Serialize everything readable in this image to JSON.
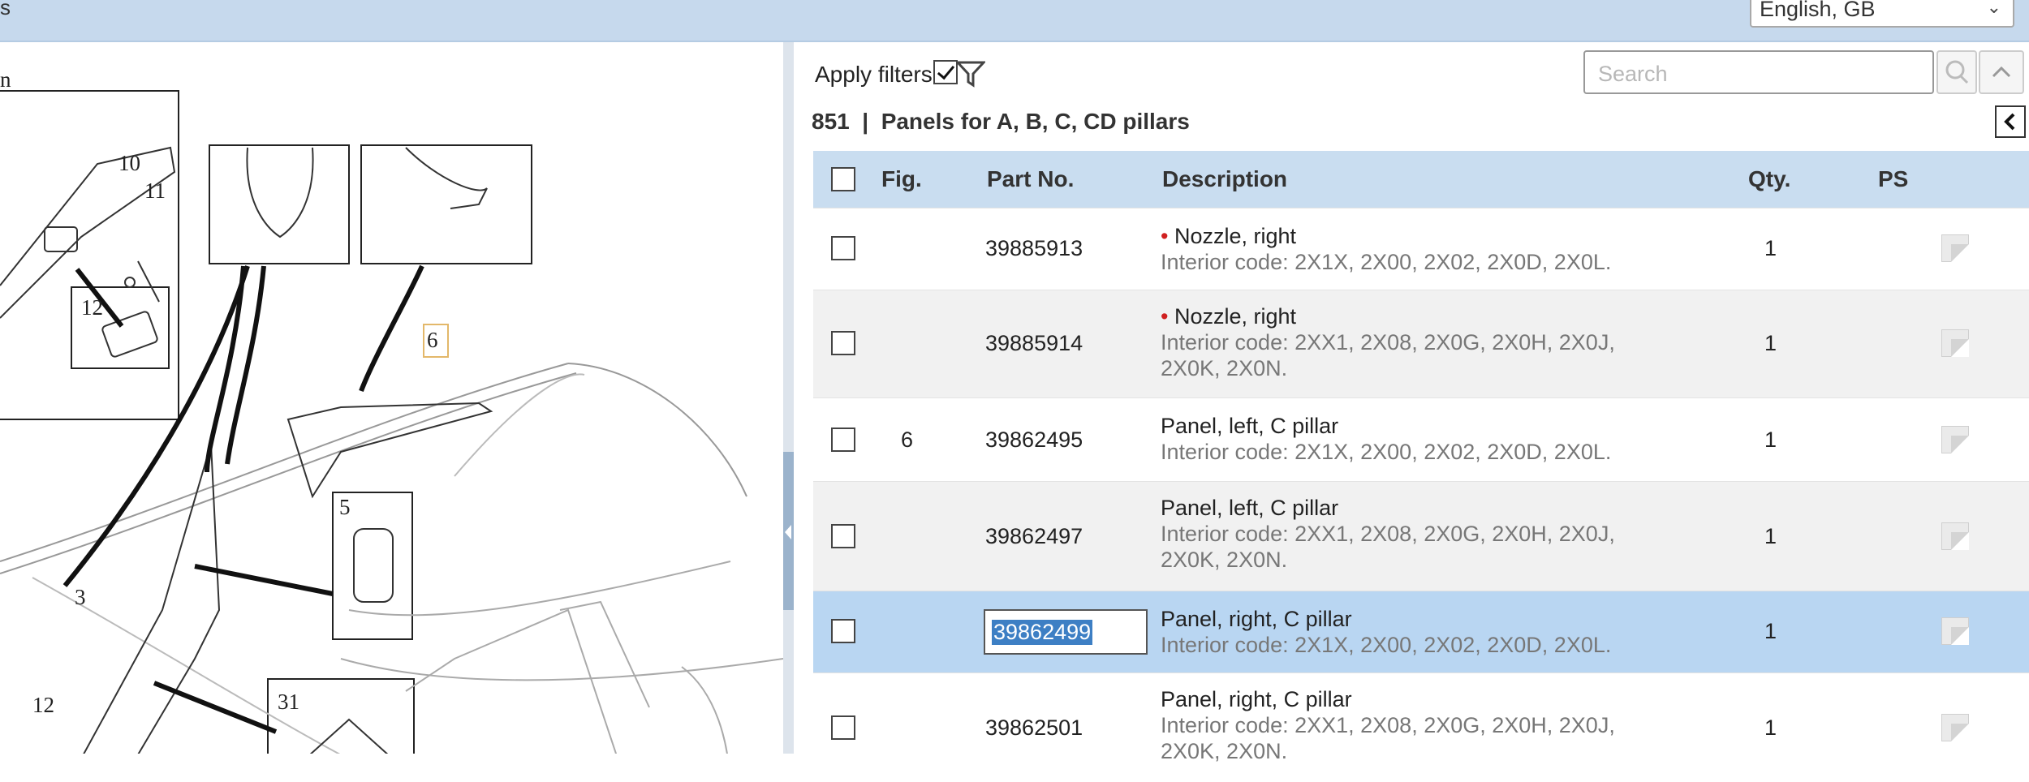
{
  "topbar": {
    "left_text": "s",
    "language": "English, GB"
  },
  "diagram": {
    "small_text": "n",
    "callouts": {
      "c10": "10",
      "c11": "11",
      "c12a": "12",
      "c6": "6",
      "c5": "5",
      "c3": "3",
      "c12b": "12",
      "c31": "31"
    }
  },
  "filters": {
    "label": "Apply filters",
    "checked": true
  },
  "search": {
    "placeholder": "Search"
  },
  "group": {
    "number": "851",
    "separator": "|",
    "name": "Panels for A, B, C, CD pillars"
  },
  "table": {
    "headers": {
      "fig": "Fig.",
      "part_no": "Part No.",
      "description": "Description",
      "qty": "Qty.",
      "ps": "PS"
    },
    "rows": [
      {
        "fig": "",
        "part_no": "39885913",
        "dot": "•",
        "desc": "Nozzle, right",
        "code1": "Interior code: 2X1X, 2X00, 2X02, 2X0D, 2X0L.",
        "code2": "",
        "qty": "1"
      },
      {
        "fig": "",
        "part_no": "39885914",
        "dot": "•",
        "desc": "Nozzle, right",
        "code1": "Interior code: 2XX1, 2X08, 2X0G, 2X0H, 2X0J,",
        "code2": "2X0K, 2X0N.",
        "qty": "1"
      },
      {
        "fig": "6",
        "part_no": "39862495",
        "dot": "",
        "desc": "Panel, left, C pillar",
        "code1": "Interior code: 2X1X, 2X00, 2X02, 2X0D, 2X0L.",
        "code2": "",
        "qty": "1"
      },
      {
        "fig": "",
        "part_no": "39862497",
        "dot": "",
        "desc": "Panel, left, C pillar",
        "code1": "Interior code: 2XX1, 2X08, 2X0G, 2X0H, 2X0J,",
        "code2": "2X0K, 2X0N.",
        "qty": "1"
      },
      {
        "fig": "",
        "part_no": "39862499",
        "dot": "",
        "desc": "Panel, right, C pillar",
        "code1": "Interior code: 2X1X, 2X00, 2X02, 2X0D, 2X0L.",
        "code2": "",
        "qty": "1"
      },
      {
        "fig": "",
        "part_no": "39862501",
        "dot": "",
        "desc": "Panel, right, C pillar",
        "code1": "Interior code: 2XX1, 2X08, 2X0G, 2X0H, 2X0J,",
        "code2": "2X0K, 2X0N.",
        "qty": "1"
      }
    ]
  }
}
